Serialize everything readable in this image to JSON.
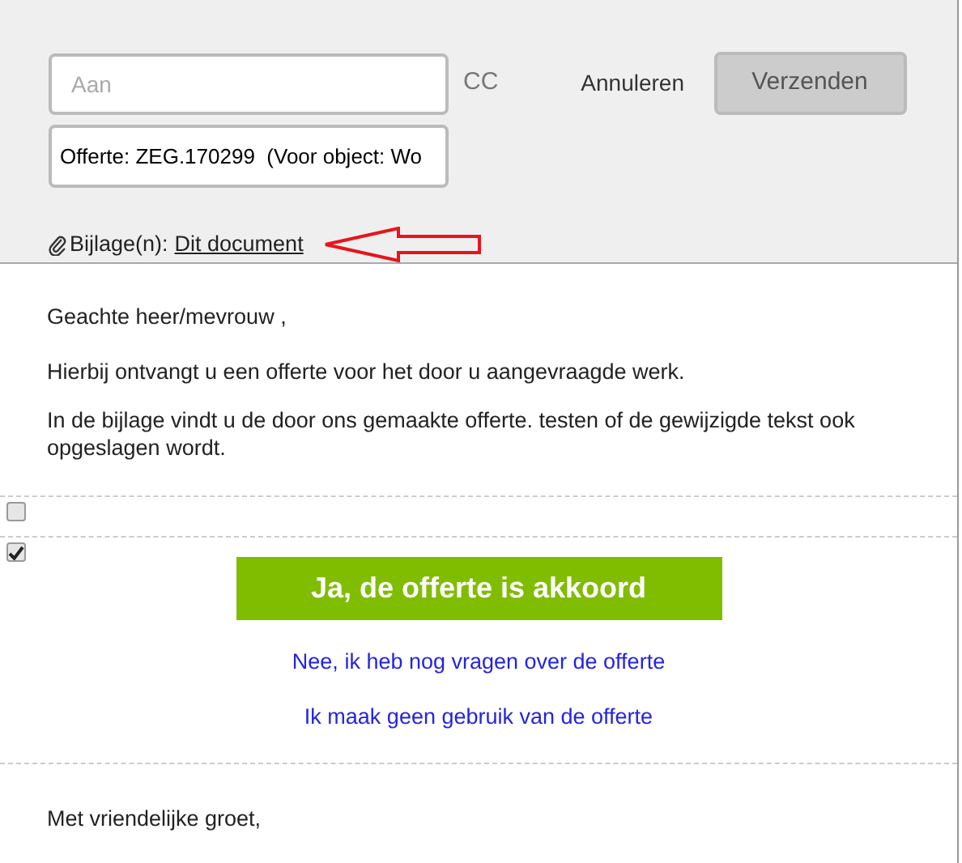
{
  "header": {
    "to_field": {
      "placeholder": "Aan"
    },
    "cc_label": "CC",
    "cancel_button": "Annuleren",
    "send_button": {
      "label": "Verzenden",
      "disabled": true
    },
    "subject_field": {
      "value": "Offerte: ZEG.170299  (Voor object: Wo"
    },
    "attachments_label": "Bijlage(n):",
    "attachment_link": "Dit document"
  },
  "body": {
    "greeting": "Geachte heer/mevrouw ,",
    "paragraphs": [
      "Hierbij ontvangt u een offerte voor het door u aangevraagde werk.",
      "In de bijlage vindt u de door ons gemaakte offerte. testen of de gewijzigde tekst ook opgeslagen wordt."
    ],
    "sections": [
      {
        "checked": false
      },
      {
        "checked": true,
        "accept_button": "Ja, de offerte is akkoord",
        "links": [
          "Nee, ik heb nog vragen over de offerte",
          "Ik maak geen gebruik van de offerte"
        ]
      }
    ],
    "closing": "Met vriendelijke groet,"
  }
}
